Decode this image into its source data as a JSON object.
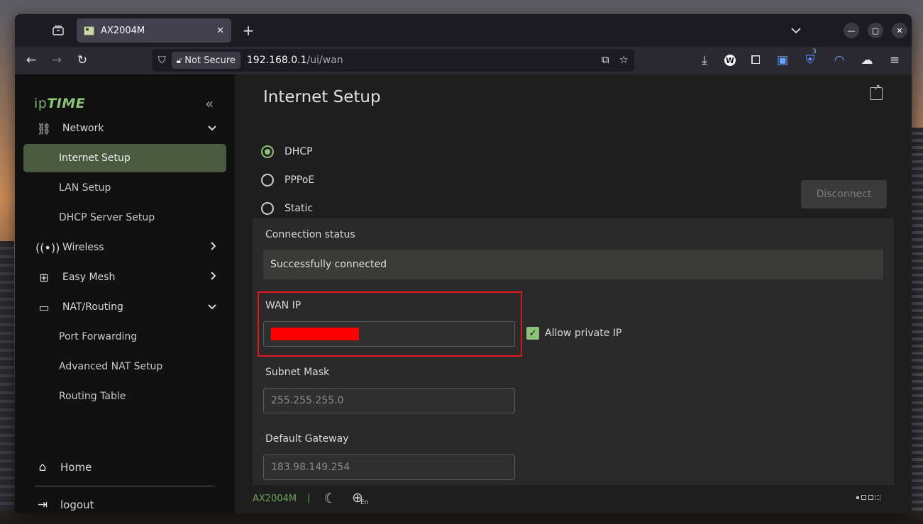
{
  "browser": {
    "tab_title": "AX2004M",
    "tab_close": "✕",
    "new_tab": "+",
    "url_security": "Not Secure",
    "url_host": "192.168.0.1",
    "url_path": "/ui/wan",
    "extension_badge": "3"
  },
  "sidebar": {
    "logo_ip": "ip",
    "logo_time": "TIME",
    "collapse_glyph": "«",
    "items": [
      {
        "label": "Network",
        "icon": "network-icon",
        "expanded": true
      },
      {
        "label": "Internet Setup",
        "active": true
      },
      {
        "label": "LAN Setup"
      },
      {
        "label": "DHCP Server Setup"
      },
      {
        "label": "Wireless",
        "icon": "antenna-icon",
        "expanded": false
      },
      {
        "label": "Easy Mesh",
        "icon": "mesh-icon",
        "expanded": false
      },
      {
        "label": "NAT/Routing",
        "icon": "router-icon",
        "expanded": true
      },
      {
        "label": "Port Forwarding"
      },
      {
        "label": "Advanced NAT Setup"
      },
      {
        "label": "Routing Table"
      }
    ],
    "home": "Home",
    "logout": "logout"
  },
  "main": {
    "title": "Internet Setup",
    "radios": [
      {
        "label": "DHCP",
        "selected": true
      },
      {
        "label": "PPPoE",
        "selected": false
      },
      {
        "label": "Static",
        "selected": false
      }
    ],
    "disconnect_label": "Disconnect",
    "connection_status_label": "Connection status",
    "connection_status_value": "Successfully connected",
    "wan_ip_label": "WAN IP",
    "allow_private_label": "Allow private IP",
    "allow_private_checked": true,
    "subnet_label": "Subnet Mask",
    "subnet_value": "255.255.255.0",
    "gateway_label": "Default Gateway",
    "gateway_value": "183.98.149.254"
  },
  "footer": {
    "model": "AX2004M",
    "separator": "|",
    "lang": "En"
  },
  "colors": {
    "accent": "#8ec27a",
    "active_item_bg": "#4a5a3e",
    "highlight_border": "#e0141a"
  }
}
